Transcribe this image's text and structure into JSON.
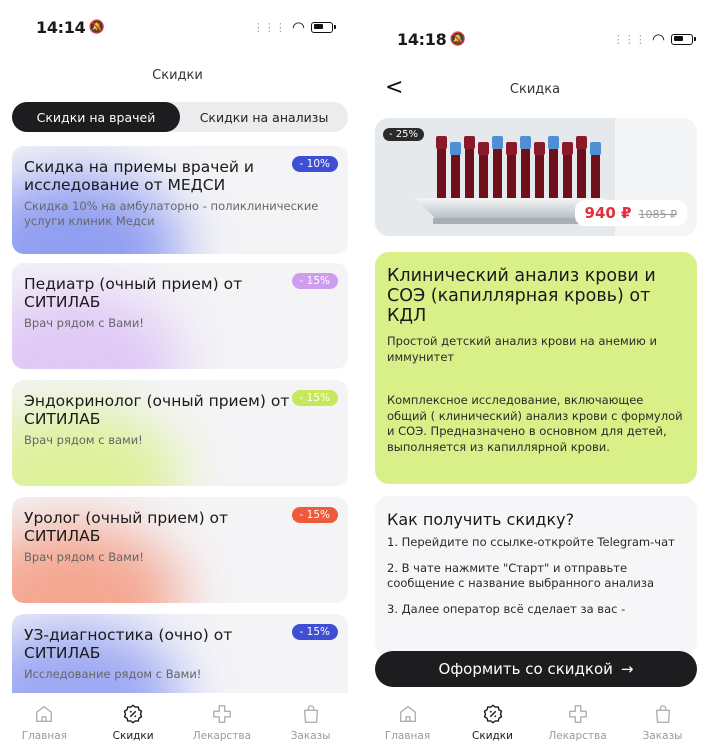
{
  "left": {
    "status": {
      "time": "14:14",
      "bell": "🔕"
    },
    "title": "Скидки",
    "tabs": [
      "Скидки на врачей",
      "Скидки на анализы"
    ],
    "cards": [
      {
        "title": "Скидка на приемы врачей и исследование от МЕДСИ",
        "desc": "Скидка 10% на амбулаторно - поликлинические услуги клиник Медси",
        "badge": "- 10%",
        "badge_color": "#3e4fd6",
        "glow_color": "#7f8ff0"
      },
      {
        "title": "Педиатр (очный прием) от СИТИЛАБ",
        "desc": "Врач рядом с Вами!",
        "badge": "- 15%",
        "badge_color": "#cf9df0",
        "glow_color": "#dcc1f6"
      },
      {
        "title": "Эндокринолог (очный прием) от СИТИЛАБ",
        "desc": "Врач рядом с вами!",
        "badge": "- 15%",
        "badge_color": "#c6e85a",
        "glow_color": "#d9f08a"
      },
      {
        "title": "Уролог (очный прием) от СИТИЛАБ",
        "desc": "Врач рядом с Вами!",
        "badge": "- 15%",
        "badge_color": "#ef5a3a",
        "glow_color": "#f49a80"
      },
      {
        "title": "УЗ-диагностика (очно) от СИТИЛАБ",
        "desc": "Исследование рядом с Вами!",
        "badge": "- 15%",
        "badge_color": "#3e4fd6",
        "glow_color": "#8e9bf2"
      }
    ]
  },
  "right": {
    "status": {
      "time": "14:18",
      "bell": "🔕"
    },
    "back": "<",
    "title": "Скидка",
    "hero": {
      "tag": "- 25%",
      "price_new": "940 ₽",
      "price_old": "1085 ₽"
    },
    "product": {
      "title": "Клинический анализ крови и СОЭ (капиллярная кровь) от КДЛ",
      "subtitle": "Простой детский анализ крови на анемию и иммунитет",
      "description": "Комплексное исследование, включающее общий ( клинический) анализ крови с формулой и СОЭ. Предназначено в основном для детей, выполняется из капиллярной крови."
    },
    "howto": {
      "title": "Как получить скидку?",
      "steps": [
        "1. Перейдите по ссылке-откройте Telegram-чат",
        "2. В чате нажмите \"Старт\" и отправьте сообщение с название выбранного анализа",
        "3. Далее оператор всё сделает за вас -"
      ]
    },
    "cta": "Оформить со скидкой",
    "cta_arrow": "→"
  },
  "nav": [
    {
      "label": "Главная",
      "icon": "home-icon"
    },
    {
      "label": "Скидки",
      "icon": "discount-icon"
    },
    {
      "label": "Лекарства",
      "icon": "medicine-cross-icon"
    },
    {
      "label": "Заказы",
      "icon": "bag-icon"
    }
  ]
}
